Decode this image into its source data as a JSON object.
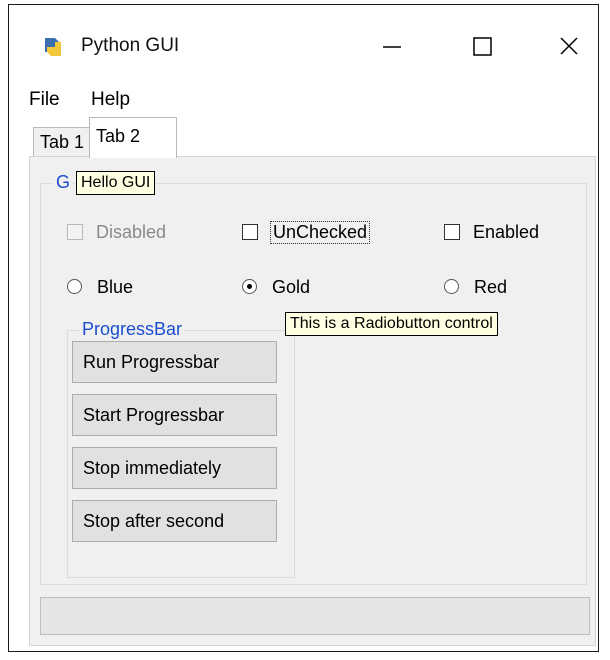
{
  "window": {
    "title": "Python GUI",
    "icon": "python-icon",
    "controls": [
      "minimize-icon",
      "maximize-icon",
      "close-icon"
    ]
  },
  "menu": {
    "items": [
      "File",
      "Help"
    ]
  },
  "tabs": [
    {
      "label": "Tab 1",
      "selected": false
    },
    {
      "label": "Tab 2",
      "selected": true
    }
  ],
  "group": {
    "label_first_char": "G"
  },
  "tooltips": {
    "hello": "Hello GUI",
    "radio": "This is a Radiobutton control"
  },
  "checkboxes": [
    {
      "label": "Disabled",
      "checked": false,
      "disabled": true
    },
    {
      "label": "UnChecked",
      "checked": false,
      "disabled": false,
      "focused": true
    },
    {
      "label": "Enabled",
      "checked": false,
      "disabled": false
    }
  ],
  "radios": [
    {
      "label": "Blue",
      "selected": false
    },
    {
      "label": "Gold",
      "selected": true
    },
    {
      "label": "Red",
      "selected": false
    }
  ],
  "progress_group": {
    "label": "ProgressBar",
    "buttons": [
      "Run Progressbar",
      "Start Progressbar",
      "Stop immediately",
      "Stop after second"
    ]
  },
  "progressbar": {
    "value": 0
  },
  "colors": {
    "accent_text": "#1a4ecf",
    "tooltip_bg": "#ffffe1",
    "panel_bg": "#f0f0f0"
  }
}
